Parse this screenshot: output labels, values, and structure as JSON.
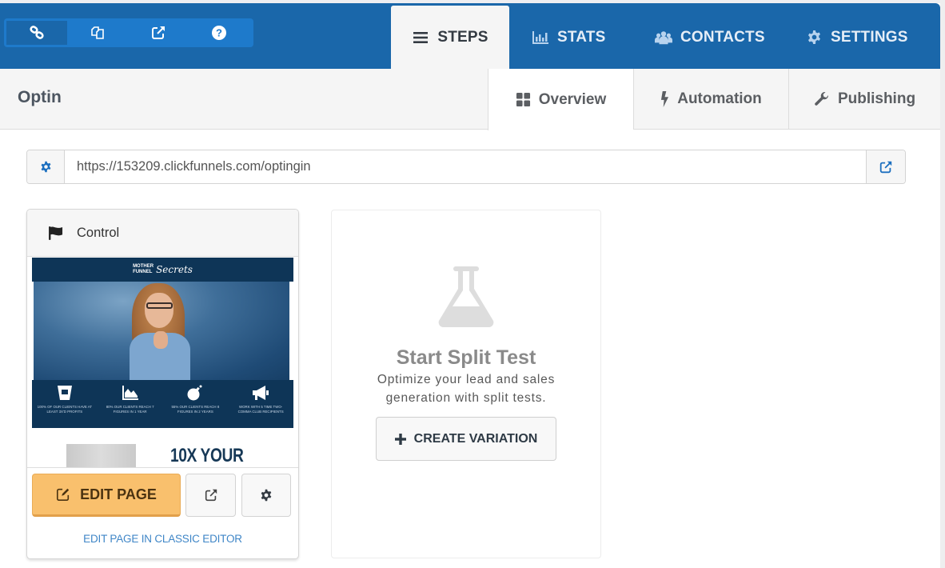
{
  "header": {
    "toolbar": [
      {
        "icon": "link-icon",
        "active": true
      },
      {
        "icon": "copy-icon",
        "active": false
      },
      {
        "icon": "external-link-icon",
        "active": false
      },
      {
        "icon": "help-icon",
        "active": false
      }
    ],
    "tabs": [
      {
        "label": "STEPS",
        "icon": "bars-icon",
        "active": true
      },
      {
        "label": "STATS",
        "icon": "bar-chart-icon",
        "active": false
      },
      {
        "label": "CONTACTS",
        "icon": "users-icon",
        "active": false
      },
      {
        "label": "SETTINGS",
        "icon": "gear-icon",
        "active": false
      }
    ]
  },
  "step": {
    "title": "Optin",
    "subtabs": [
      {
        "label": "Overview",
        "icon": "grid-icon",
        "active": true
      },
      {
        "label": "Automation",
        "icon": "bolt-icon",
        "active": false
      },
      {
        "label": "Publishing",
        "icon": "wrench-icon",
        "active": false
      }
    ]
  },
  "url": {
    "value": "https://153209.clickfunnels.com/optingin"
  },
  "control": {
    "title": "Control",
    "preview": {
      "logo_line1": "MOTHER",
      "logo_line2": "FUNNEL",
      "logo_script": "Secrets",
      "stats": [
        {
          "icon": "bucket-icon",
          "text": "100% of our clients have at least 3X'd profits"
        },
        {
          "icon": "area-chart-icon",
          "text": "80% our clients reach 7 figures in 1 year"
        },
        {
          "icon": "bomb-icon",
          "text": "55% our clients reach 8 figures in 2 years"
        },
        {
          "icon": "megaphone-icon",
          "text": "Work with 5 time two-comma club recipients"
        }
      ],
      "headline": "10X YOUR"
    },
    "edit_label": "EDIT PAGE",
    "classic_link": "EDIT PAGE IN CLASSIC EDITOR"
  },
  "split_test": {
    "title": "Start Split Test",
    "description_line1": "Optimize your lead and sales",
    "description_line2": "generation with split tests.",
    "button_label": "CREATE VARIATION"
  },
  "colors": {
    "header_blue": "#1a67aa",
    "toolbar_blue": "#1e7acb",
    "edit_button": "#f9c06d",
    "link_blue": "#3f86c7"
  }
}
